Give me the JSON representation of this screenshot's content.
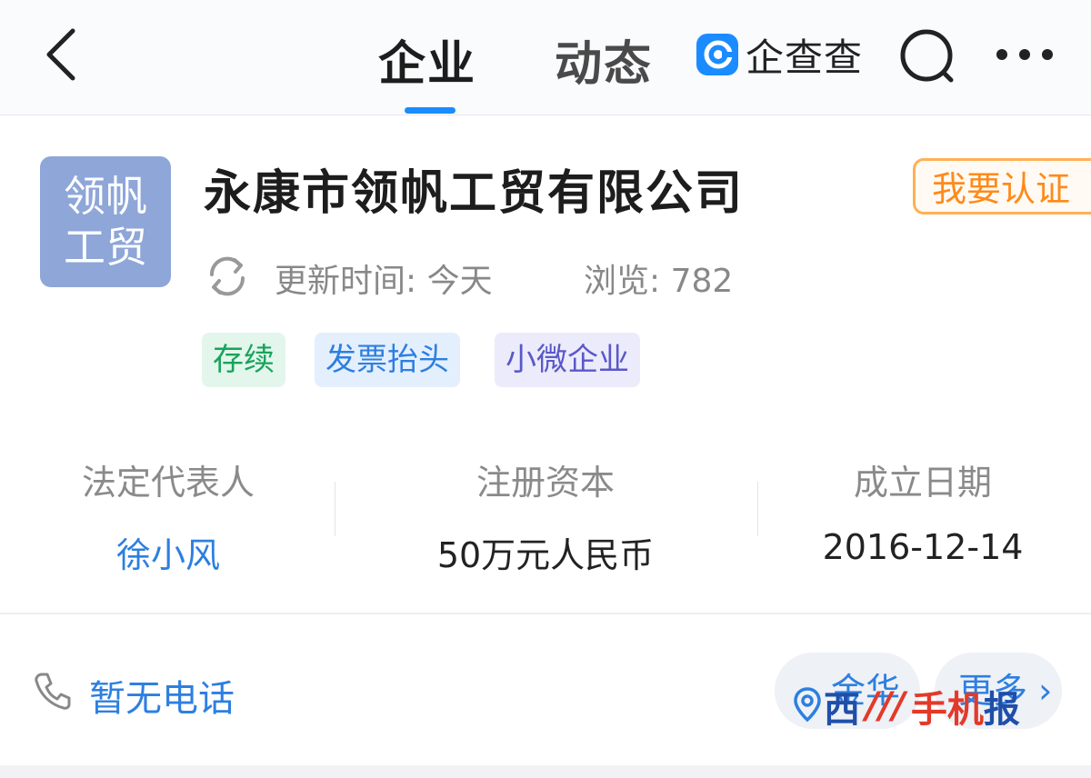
{
  "nav": {
    "tabs": [
      {
        "label": "企业",
        "active": true
      },
      {
        "label": "动态",
        "active": false
      }
    ],
    "brand_text": "企查查",
    "icons": {
      "back": "chevron-left-icon",
      "search": "search-icon",
      "more": "more-dots-icon",
      "brand": "qichacha-logo"
    }
  },
  "company": {
    "logo_text": [
      "领帆",
      "工贸"
    ],
    "name": "永康市领帆工贸有限公司",
    "certify_label": "我要认证",
    "update_label": "更新时间: 今天",
    "views_label": "浏览: 782",
    "tags": [
      "存续",
      "发票抬头",
      "小微企业"
    ]
  },
  "info": [
    {
      "label": "法定代表人",
      "value": "徐小风"
    },
    {
      "label": "注册资本",
      "value": "50万元人民币"
    },
    {
      "label": "成立日期",
      "value": "2016-12-14"
    }
  ],
  "contact": {
    "phone_label": "暂无电话",
    "address_label": "金华",
    "more_label": "更多"
  },
  "watermark": [
    "西",
    "///",
    "手机",
    "报"
  ],
  "colors": {
    "accent_blue": "#1a8cff",
    "link_blue": "#2d7fe0",
    "certify_orange": "#ff8a1a",
    "status_green": "#19a35c",
    "tag_purple": "#5a58c8",
    "logo_bg": "#8ea6d8"
  }
}
